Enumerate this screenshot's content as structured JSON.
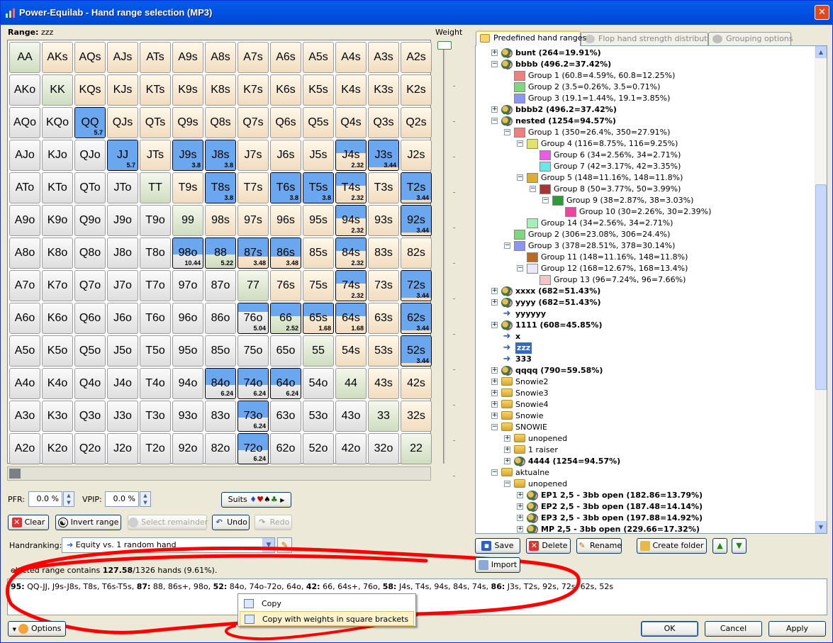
{
  "window": {
    "title": "Power-Equilab - Hand range selection (MP3)",
    "close_label": "✕"
  },
  "range": {
    "label": "Range:",
    "name": "zzz"
  },
  "weight_label": "Weight",
  "grid": [
    [
      "AA",
      "AKs",
      "AQs",
      "AJs",
      "ATs",
      "A9s",
      "A8s",
      "A7s",
      "A6s",
      "A5s",
      "A4s",
      "A3s",
      "A2s"
    ],
    [
      "AKo",
      "KK",
      "KQs",
      "KJs",
      "KTs",
      "K9s",
      "K8s",
      "K7s",
      "K6s",
      "K5s",
      "K4s",
      "K3s",
      "K2s"
    ],
    [
      "AQo",
      "KQo",
      "QQ",
      "QJs",
      "QTs",
      "Q9s",
      "Q8s",
      "Q7s",
      "Q6s",
      "Q5s",
      "Q4s",
      "Q3s",
      "Q2s"
    ],
    [
      "AJo",
      "KJo",
      "QJo",
      "JJ",
      "JTs",
      "J9s",
      "J8s",
      "J7s",
      "J6s",
      "J5s",
      "J4s",
      "J3s",
      "J2s"
    ],
    [
      "ATo",
      "KTo",
      "QTo",
      "JTo",
      "TT",
      "T9s",
      "T8s",
      "T7s",
      "T6s",
      "T5s",
      "T4s",
      "T3s",
      "T2s"
    ],
    [
      "A9o",
      "K9o",
      "Q9o",
      "J9o",
      "T9o",
      "99",
      "98s",
      "97s",
      "96s",
      "95s",
      "94s",
      "93s",
      "92s"
    ],
    [
      "A8o",
      "K8o",
      "Q8o",
      "J8o",
      "T8o",
      "98o",
      "88",
      "87s",
      "86s",
      "85s",
      "84s",
      "83s",
      "82s"
    ],
    [
      "A7o",
      "K7o",
      "Q7o",
      "J7o",
      "T7o",
      "97o",
      "87o",
      "77",
      "76s",
      "75s",
      "74s",
      "73s",
      "72s"
    ],
    [
      "A6o",
      "K6o",
      "Q6o",
      "J6o",
      "T6o",
      "96o",
      "86o",
      "76o",
      "66",
      "65s",
      "64s",
      "63s",
      "62s"
    ],
    [
      "A5o",
      "K5o",
      "Q5o",
      "J5o",
      "T5o",
      "95o",
      "85o",
      "75o",
      "65o",
      "55",
      "54s",
      "53s",
      "52s"
    ],
    [
      "A4o",
      "K4o",
      "Q4o",
      "J4o",
      "T4o",
      "94o",
      "84o",
      "74o",
      "64o",
      "54o",
      "44",
      "43s",
      "42s"
    ],
    [
      "A3o",
      "K3o",
      "Q3o",
      "J3o",
      "T3o",
      "93o",
      "83o",
      "73o",
      "63o",
      "53o",
      "43o",
      "33",
      "32s"
    ],
    [
      "A2o",
      "K2o",
      "Q2o",
      "J2o",
      "T2o",
      "92o",
      "82o",
      "72o",
      "62o",
      "52o",
      "42o",
      "32o",
      "22"
    ]
  ],
  "weights": {
    "QQ": {
      "label": "5.7",
      "level": 0.95
    },
    "JJ": {
      "label": "5.7",
      "level": 0.95
    },
    "J9s": {
      "label": "3.8",
      "level": 0.95
    },
    "J8s": {
      "label": "3.8",
      "level": 0.95
    },
    "J4s": {
      "label": "2.32",
      "level": 0.42
    },
    "J3s": {
      "label": "3.44",
      "level": 0.86
    },
    "T8s": {
      "label": "3.8",
      "level": 0.95
    },
    "T6s": {
      "label": "3.8",
      "level": 0.95
    },
    "T5s": {
      "label": "3.8",
      "level": 0.95
    },
    "T4s": {
      "label": "2.32",
      "level": 0.42
    },
    "T2s": {
      "label": "3.44",
      "level": 0.86
    },
    "94s": {
      "label": "2.32",
      "level": 0.42
    },
    "92s": {
      "label": "3.44",
      "level": 0.86
    },
    "98o": {
      "label": "10.44",
      "level": 0.52
    },
    "88": {
      "label": "5.22",
      "level": 0.52
    },
    "87s": {
      "label": "3.48",
      "level": 0.58
    },
    "86s": {
      "label": "3.48",
      "level": 0.58
    },
    "84s": {
      "label": "2.32",
      "level": 0.42
    },
    "74s": {
      "label": "2.32",
      "level": 0.42
    },
    "72s": {
      "label": "3.44",
      "level": 0.86
    },
    "76o": {
      "label": "5.04",
      "level": 0.28
    },
    "66": {
      "label": "2.52",
      "level": 0.42
    },
    "65s": {
      "label": "1.68",
      "level": 0.42
    },
    "64s": {
      "label": "1.68",
      "level": 0.42
    },
    "62s": {
      "label": "3.44",
      "level": 0.86
    },
    "52s": {
      "label": "3.44",
      "level": 0.86
    },
    "84o": {
      "label": "6.24",
      "level": 0.52
    },
    "74o": {
      "label": "6.24",
      "level": 0.52
    },
    "64o": {
      "label": "6.24",
      "level": 0.52
    },
    "73o": {
      "label": "6.24",
      "level": 0.52
    },
    "72o": {
      "label": "6.24",
      "level": 0.52
    }
  },
  "pfr": {
    "label": "PFR:",
    "value": "0.0 %"
  },
  "vpip": {
    "label": "VPIP:",
    "value": "0.0 %"
  },
  "suits_button": "Suits",
  "suit_symbols": [
    "♦",
    "♥",
    "♠",
    "♣"
  ],
  "buttons": {
    "clear": "Clear",
    "invert": "Invert range",
    "select_remainder": "Select remainder",
    "undo": "Undo",
    "redo": "Redo",
    "save": "Save",
    "delete": "Delete",
    "rename": "Rename",
    "create_folder": "Create folder",
    "import": "Import",
    "options": "Options",
    "ok": "OK",
    "cancel": "Cancel",
    "apply": "Apply"
  },
  "handranking": {
    "label": "Handranking:",
    "value": "Equity vs. 1 random hand"
  },
  "status": {
    "prefix": "elected range contains ",
    "count": "127.58",
    "suffix": "/1326 hands (9.61%)."
  },
  "result": [
    {
      "w": "95:",
      "t": " QQ-JJ, J9s-J8s, T8s, T6s-T5s, "
    },
    {
      "w": "87:",
      "t": " 88, 86s+, 98o, "
    },
    {
      "w": "52:",
      "t": " 84o, 74o-72o, 64o, "
    },
    {
      "w": "42:",
      "t": " 66, 64s+, 76o, "
    },
    {
      "w": "58:",
      "t": " J4s, T4s, 94s, 84s, 74s, "
    },
    {
      "w": "86:",
      "t": " J3s, T2s, 92s, 72s, 62s, 52s"
    }
  ],
  "context_menu": [
    "Copy",
    "Copy with weights in square brackets"
  ],
  "tabs": [
    "Predefined hand ranges",
    "Flop hand strength distribution",
    "Grouping options"
  ],
  "tree": [
    {
      "d": 0,
      "exp": "+",
      "icon": "users",
      "t": "bunt (264=19.91%)",
      "b": true
    },
    {
      "d": 0,
      "exp": "-",
      "icon": "users",
      "t": "bbbb (496.2=37.42%)",
      "b": true
    },
    {
      "d": 1,
      "sw": "#f08080",
      "t": "Group 1 (60.8=4.59%, 60.8=12.25%)"
    },
    {
      "d": 1,
      "sw": "#7ed67e",
      "t": "Group 2 (3.5=0.26%, 3.5=0.71%)"
    },
    {
      "d": 1,
      "sw": "#8c95ef",
      "t": "Group 3 (19.1=1.44%, 19.1=3.85%)"
    },
    {
      "d": 0,
      "exp": "+",
      "icon": "users",
      "t": "bbbb2 (496.2=37.42%)",
      "b": true
    },
    {
      "d": 0,
      "exp": "-",
      "icon": "users",
      "t": "nested (1254=94.57%)",
      "b": true
    },
    {
      "d": 1,
      "exp": "-",
      "sw": "#f08080",
      "t": "Group 1 (350=26.4%, 350=27.91%)"
    },
    {
      "d": 2,
      "exp": "-",
      "sw": "#e3e36a",
      "t": "Group 4 (116=8.75%, 116=9.25%)"
    },
    {
      "d": 3,
      "sw": "#ea5ce8",
      "t": "Group 6 (34=2.56%, 34=2.71%)"
    },
    {
      "d": 3,
      "sw": "#6ce6e6",
      "t": "Group 7 (42=3.17%, 42=3.35%)"
    },
    {
      "d": 2,
      "exp": "-",
      "sw": "#d9ad36",
      "t": "Group 5 (148=11.16%, 148=11.8%)"
    },
    {
      "d": 3,
      "exp": "-",
      "sw": "#a83434",
      "t": "Group 8 (50=3.77%, 50=3.99%)"
    },
    {
      "d": 4,
      "exp": "-",
      "sw": "#2e9a3a",
      "t": "Group 9 (38=2.87%, 38=3.03%)"
    },
    {
      "d": 5,
      "sw": "#f0429e",
      "t": "Group 10 (30=2.26%, 30=2.39%)"
    },
    {
      "d": 2,
      "sw": "#a6efb8",
      "t": "Group 14 (34=2.56%, 34=2.71%)"
    },
    {
      "d": 1,
      "sw": "#7ed67e",
      "t": "Group 2 (306=23.08%, 306=24.4%)"
    },
    {
      "d": 1,
      "exp": "-",
      "sw": "#8c95ef",
      "t": "Group 3 (378=28.51%, 378=30.14%)"
    },
    {
      "d": 2,
      "sw": "#b86a28",
      "t": "Group 11 (148=11.16%, 148=11.8%)"
    },
    {
      "d": 2,
      "exp": "-",
      "sw": "#ece8fa",
      "t": "Group 12 (168=12.67%, 168=13.4%)"
    },
    {
      "d": 3,
      "sw": "#f3c5c5",
      "t": "Group 13 (96=7.24%, 96=7.66%)"
    },
    {
      "d": 0,
      "exp": "+",
      "icon": "users",
      "t": "xxxx (682=51.43%)",
      "b": true
    },
    {
      "d": 0,
      "exp": "+",
      "icon": "users",
      "t": "yyyy (682=51.43%)",
      "b": true
    },
    {
      "d": 0,
      "icon": "arrow",
      "t": "yyyyyy",
      "b": true
    },
    {
      "d": 0,
      "exp": "+",
      "icon": "users",
      "t": "1111 (608=45.85%)",
      "b": true
    },
    {
      "d": 0,
      "icon": "arrow",
      "t": "x",
      "b": true
    },
    {
      "d": 0,
      "icon": "arrow",
      "t": "zzz",
      "b": true,
      "sel": true
    },
    {
      "d": 0,
      "icon": "arrow",
      "t": "333",
      "b": true
    },
    {
      "d": 0,
      "exp": "+",
      "icon": "users",
      "t": "qqqq (790=59.58%)",
      "b": true
    },
    {
      "d": 0,
      "exp": "+",
      "icon": "folder",
      "t": "Snowie2"
    },
    {
      "d": 0,
      "exp": "+",
      "icon": "folder",
      "t": "Snowie3"
    },
    {
      "d": 0,
      "exp": "+",
      "icon": "folder",
      "t": "Snowie4"
    },
    {
      "d": 0,
      "exp": "+",
      "icon": "folder",
      "t": "Snowie"
    },
    {
      "d": 0,
      "exp": "-",
      "icon": "folder",
      "t": "SNOWIE"
    },
    {
      "d": 1,
      "exp": "+",
      "icon": "folder",
      "t": "unopened"
    },
    {
      "d": 1,
      "exp": "+",
      "icon": "folder",
      "t": "1 raiser"
    },
    {
      "d": 1,
      "exp": "+",
      "icon": "users",
      "t": "4444 (1254=94.57%)",
      "b": true
    },
    {
      "d": 0,
      "exp": "-",
      "icon": "folder",
      "t": "aktualne"
    },
    {
      "d": 1,
      "exp": "-",
      "icon": "folder",
      "t": "unopened"
    },
    {
      "d": 2,
      "exp": "+",
      "icon": "users",
      "t": "EP1 2,5 - 3bb open (182.86=13.79%)",
      "b": true
    },
    {
      "d": 2,
      "exp": "+",
      "icon": "users",
      "t": "EP2 2,5 - 3bb open (187.48=14.14%)",
      "b": true
    },
    {
      "d": 2,
      "exp": "+",
      "icon": "users",
      "t": "EP3 2,5 - 3bb open (197.88=14.92%)",
      "b": true
    },
    {
      "d": 2,
      "exp": "+",
      "icon": "users",
      "t": "MP 2,5 - 3bb open (229.66=17.32%)",
      "b": true
    }
  ]
}
